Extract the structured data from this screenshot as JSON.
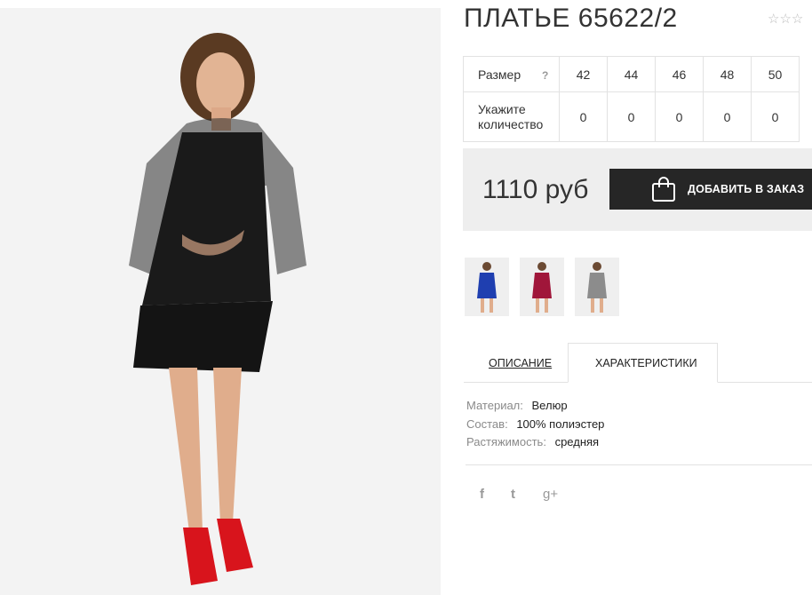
{
  "product": {
    "title": "ПЛАТЬЕ 65622/2",
    "rating_stars": "☆☆☆",
    "price": "1110 руб",
    "order_button": "ДОБАВИТЬ В ЗАКАЗ"
  },
  "size_table": {
    "size_label": "Размер",
    "help": "?",
    "qty_label_line1": "Укажите",
    "qty_label_line2": "количество",
    "sizes": [
      "42",
      "44",
      "46",
      "48",
      "50"
    ],
    "quantities": [
      "0",
      "0",
      "0",
      "0",
      "0"
    ]
  },
  "thumbnails": [
    {
      "color": "#1f3fb0"
    },
    {
      "color": "#a0163a"
    },
    {
      "color": "#8c8c8c"
    }
  ],
  "tabs": {
    "description": "ОПИСАНИЕ",
    "characteristics": "ХАРАКТЕРИСТИКИ"
  },
  "specs": [
    {
      "key": "Материал:",
      "value": "Велюр"
    },
    {
      "key": "Состав:",
      "value": "100% полиэстер"
    },
    {
      "key": "Растяжимость:",
      "value": "средняя"
    }
  ],
  "social": {
    "facebook": "f",
    "twitter": "t",
    "google_plus": "g+"
  },
  "colors": {
    "button_bg": "#262626",
    "price_box_bg": "#eeeeee",
    "dress": "#111111",
    "shoes": "#d8141c"
  }
}
